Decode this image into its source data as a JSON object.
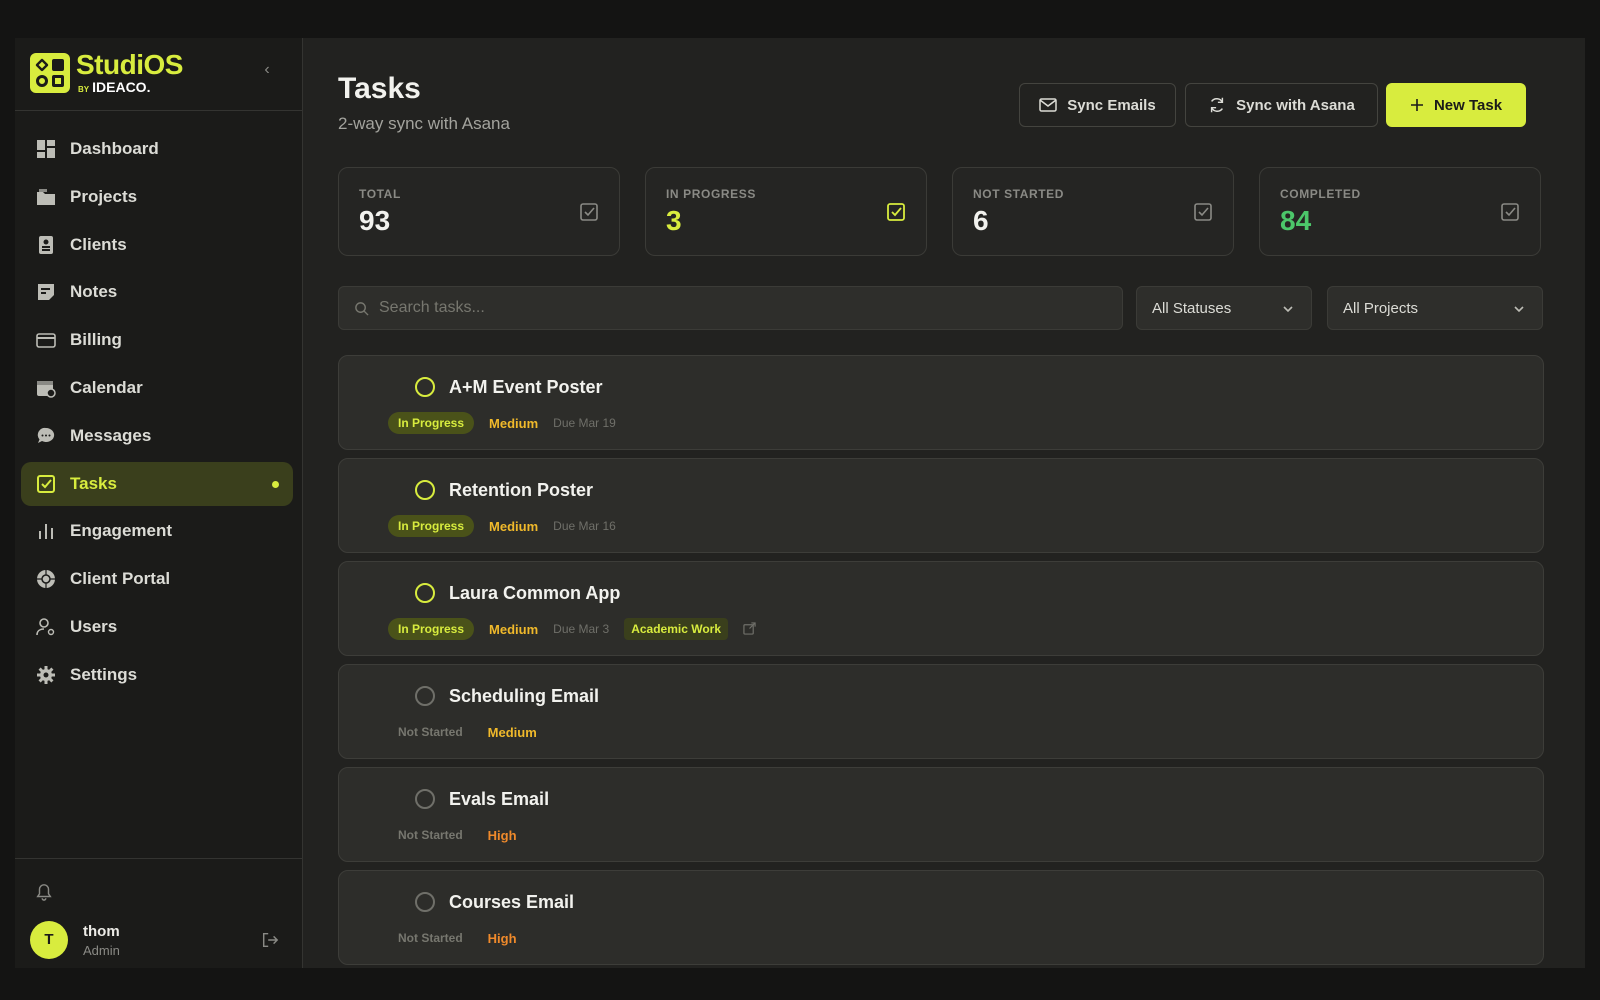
{
  "brand": {
    "name": "StudiOS",
    "by": "BY",
    "company": "IDEACO."
  },
  "nav": {
    "items": [
      {
        "label": "Dashboard",
        "icon": "dashboard-icon"
      },
      {
        "label": "Projects",
        "icon": "folder-icon"
      },
      {
        "label": "Clients",
        "icon": "contact-card-icon"
      },
      {
        "label": "Notes",
        "icon": "note-icon"
      },
      {
        "label": "Billing",
        "icon": "credit-card-icon"
      },
      {
        "label": "Calendar",
        "icon": "calendar-icon"
      },
      {
        "label": "Messages",
        "icon": "chat-bubble-icon"
      },
      {
        "label": "Tasks",
        "icon": "checkbox-icon",
        "active": true
      },
      {
        "label": "Engagement",
        "icon": "bar-chart-icon"
      },
      {
        "label": "Client Portal",
        "icon": "aperture-icon"
      },
      {
        "label": "Users",
        "icon": "user-icon"
      },
      {
        "label": "Settings",
        "icon": "gear-icon"
      }
    ]
  },
  "user": {
    "initial": "T",
    "name": "thom",
    "role": "Admin"
  },
  "header": {
    "title": "Tasks",
    "subtitle": "2-way sync with Asana",
    "sync_emails": "Sync Emails",
    "sync_asana": "Sync with Asana",
    "new_task": "New Task"
  },
  "stats": [
    {
      "label": "TOTAL",
      "value": "93",
      "color": "#f2f2ee"
    },
    {
      "label": "IN PROGRESS",
      "value": "3",
      "color": "#d8ec3e"
    },
    {
      "label": "NOT STARTED",
      "value": "6",
      "color": "#f2f2ee"
    },
    {
      "label": "COMPLETED",
      "value": "84",
      "color": "#4cc76a"
    }
  ],
  "filters": {
    "search_placeholder": "Search tasks...",
    "status": "All Statuses",
    "project": "All Projects"
  },
  "tasks": [
    {
      "name": "A+M Event Poster",
      "status": "In Progress",
      "priority": "Medium",
      "due": "Due Mar 19"
    },
    {
      "name": "Retention Poster",
      "status": "In Progress",
      "priority": "Medium",
      "due": "Due Mar 16"
    },
    {
      "name": "Laura Common App",
      "status": "In Progress",
      "priority": "Medium",
      "due": "Due Mar 3",
      "tag": "Academic Work"
    },
    {
      "name": "Scheduling Email",
      "status": "Not Started",
      "priority": "Medium"
    },
    {
      "name": "Evals Email",
      "status": "Not Started",
      "priority": "High"
    },
    {
      "name": "Courses Email",
      "status": "Not Started",
      "priority": "High"
    }
  ],
  "colors": {
    "accent": "#d8ec3e",
    "medium": "#f0b92b",
    "high": "#f08a2b",
    "completed": "#4cc76a"
  }
}
